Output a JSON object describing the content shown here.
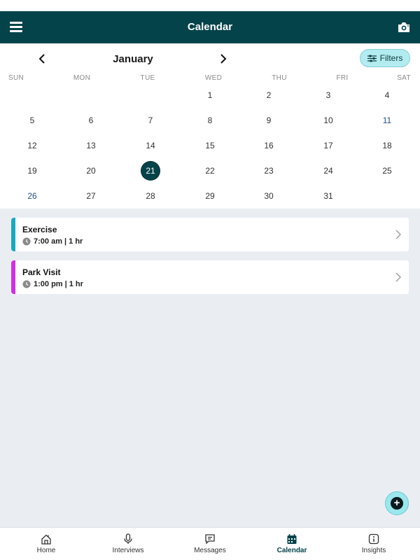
{
  "header": {
    "title": "Calendar"
  },
  "calendar": {
    "month": "January",
    "filters_label": "Filters",
    "weekdays": [
      "SUN",
      "MON",
      "TUE",
      "WED",
      "THU",
      "FRI",
      "SAT"
    ],
    "days": [
      "1",
      "2",
      "3",
      "4",
      "5",
      "6",
      "7",
      "8",
      "9",
      "10",
      "11",
      "12",
      "13",
      "14",
      "15",
      "16",
      "17",
      "18",
      "19",
      "20",
      "21",
      "22",
      "23",
      "24",
      "25",
      "26",
      "27",
      "28",
      "29",
      "30",
      "31"
    ],
    "selected_day": "21"
  },
  "events": [
    {
      "title": "Exercise",
      "time": "7:00 am | 1 hr",
      "color": "#19a9c2"
    },
    {
      "title": "Park Visit",
      "time": "1:00 pm | 1 hr",
      "color": "#d12ee8"
    }
  ],
  "tabs": [
    {
      "label": "Home",
      "icon": "home-icon"
    },
    {
      "label": "Interviews",
      "icon": "microphone-icon"
    },
    {
      "label": "Messages",
      "icon": "message-icon"
    },
    {
      "label": "Calendar",
      "icon": "calendar-icon"
    },
    {
      "label": "Insights",
      "icon": "info-icon"
    }
  ],
  "active_tab": "Calendar",
  "colors": {
    "brand": "#04434a",
    "accent": "#b3ecf0",
    "background": "#eaeef3"
  }
}
